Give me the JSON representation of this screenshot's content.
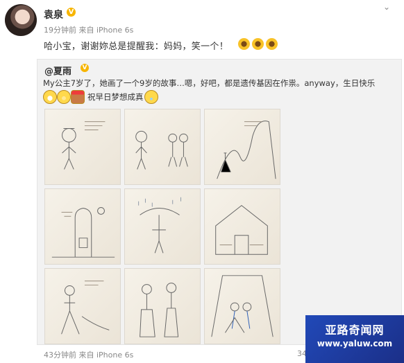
{
  "post": {
    "user": "袁泉",
    "time_source": "19分钟前 来自 iPhone 6s",
    "text": "哈小宝，谢谢妳总是提醒我：妈妈，笑一个！"
  },
  "repost": {
    "user": "@夏雨",
    "text1": "My公主7岁了，她画了一个9岁的故事…嗯，好吧，都是遗传基因在作祟。anyway，生日快乐",
    "text2": "祝早日梦想成真"
  },
  "footer": {
    "time_source": "43分钟前 来自 iPhone 6s",
    "count": "34"
  },
  "watermark": {
    "line1": "亚路奇闻网",
    "line2": "www.yaluw.com"
  }
}
